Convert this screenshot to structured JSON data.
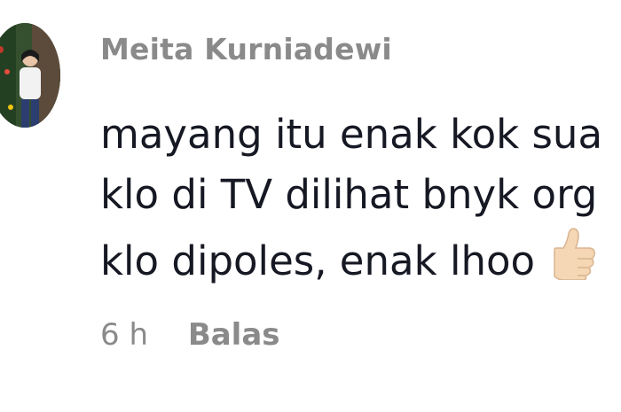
{
  "comment": {
    "author": "Meita Kurniadewi",
    "avatar_icon": "profile-photo",
    "lines": [
      "mayang itu enak kok sua",
      "klo di TV dilihat bnyk org",
      "klo dipoles, enak lhoo"
    ],
    "emoji_icon": "thumbs-up-icon",
    "time": "6 h",
    "reply_label": "Balas"
  },
  "colors": {
    "author": "#8a8a8a",
    "text": "#161823",
    "meta": "#8a8a8a",
    "emoji_skin": "#f5d7b5"
  }
}
